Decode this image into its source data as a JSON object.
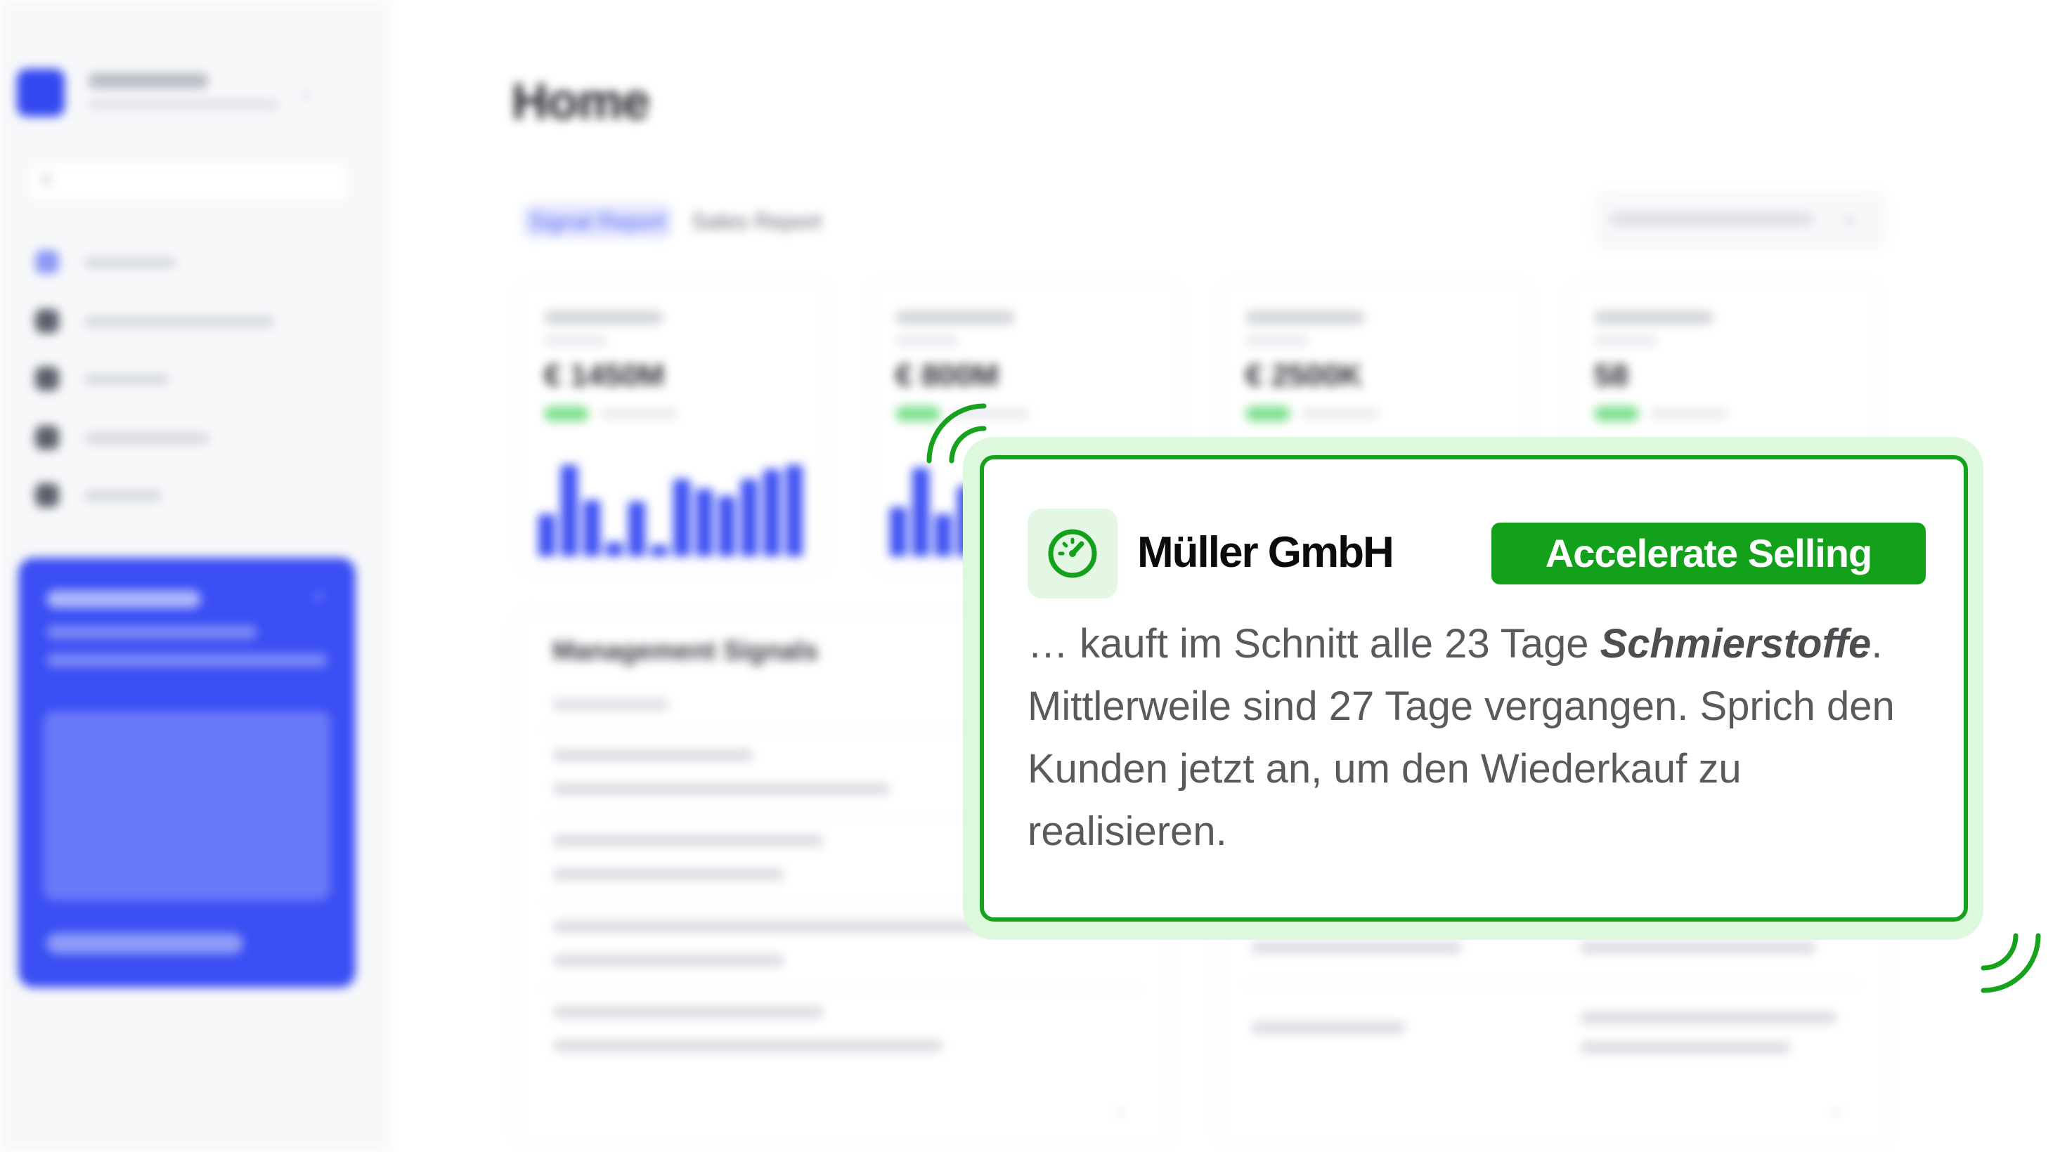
{
  "page": {
    "title": "Home",
    "tabs": [
      {
        "label": "Signal Report",
        "active": true
      },
      {
        "label": "Sales Report",
        "active": false
      }
    ]
  },
  "sidebar": {
    "accent_color": "#3348f0"
  },
  "kpis": [
    {
      "value": "€ 1450M"
    },
    {
      "value": "€ 800M"
    },
    {
      "value": "€ 2500K"
    },
    {
      "value": "58"
    }
  ],
  "management_signals": {
    "title": "Management Signals"
  },
  "popup": {
    "company": "Müller GmbH",
    "badge": "Accelerate Selling",
    "icon": "speedometer-icon",
    "message_start": "… kauft im Schnitt alle 23 Tage ",
    "message_emphasis": "Schmierstoffe",
    "message_end": ". Mittlerweile sind 27 Tage vergangen. Sprich den Kunden jetzt an, um den Wiederkauf zu realisieren.",
    "accent_color": "#13a11b"
  }
}
